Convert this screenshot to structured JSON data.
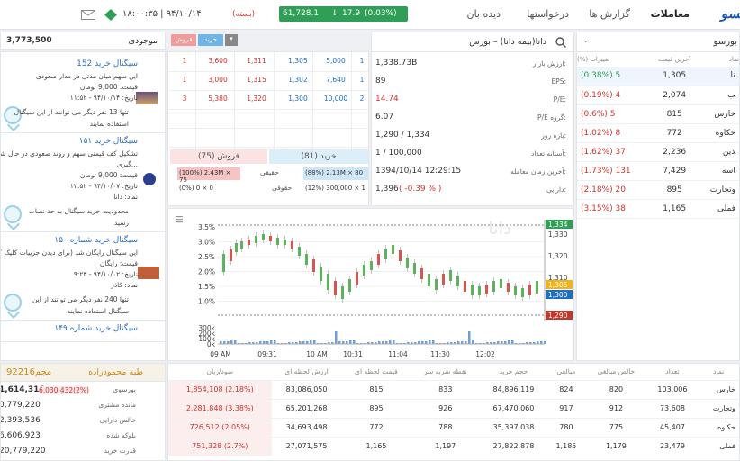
{
  "topbar": {
    "logo": "ﺴﻮ",
    "nav": [
      "معاملات",
      "گزارش ها",
      "درخواستها",
      "دیده بان"
    ],
    "index": {
      "value": "61,728.1",
      "change": "17.9",
      "percent": "(0.03%)"
    },
    "clock": "۱۸:۰۰:۳۵ | ۹۴/۱۰/۱۴",
    "clock_status": "(بسته)",
    "mail_icon": "mail-icon",
    "signal_icon": "signal-icon"
  },
  "watchlist": {
    "title": "بورسو",
    "headers": [
      "نماد",
      "آخرین قیمت",
      "تغییرات (%)"
    ],
    "rows": [
      {
        "symbol": "ﻨﺎ",
        "price": "1,305",
        "change": "(0.38%) 5",
        "dir": "green"
      },
      {
        "symbol": "ﺐ",
        "price": "2,074",
        "change": "(0.19%) 4",
        "dir": "red"
      },
      {
        "symbol": "خارس",
        "price": "815",
        "change": "(0.6%) 5",
        "dir": "red"
      },
      {
        "symbol": "حکاوه",
        "price": "772",
        "change": "(1.02%) 8",
        "dir": "red"
      },
      {
        "symbol": "ﺬﯾﻦ",
        "price": "2,236",
        "change": "(1.62%) 37",
        "dir": "red"
      },
      {
        "symbol": "ﺎﺳﻪ",
        "price": "7,429",
        "change": "(1.73%) 131",
        "dir": "red"
      },
      {
        "symbol": "وتجارت",
        "price": "895",
        "change": "(2.18%) 20",
        "dir": "red"
      },
      {
        "symbol": "فملی",
        "price": "1,165",
        "change": "(3.15%) 38",
        "dir": "red"
      }
    ]
  },
  "symbol_info": {
    "title": "دانا(بیمه دانا) – بورس",
    "fields": [
      {
        "label": "ارزش بازار:",
        "value": "1,338.73B",
        "color": "dark"
      },
      {
        "label": "EPS:",
        "value": "89",
        "color": "dark"
      },
      {
        "label": "P/E:",
        "value": "14.74",
        "color": "red"
      },
      {
        "label": "P/E گروه:",
        "value": "6.07",
        "color": "dark"
      },
      {
        "label": "بازه روز:",
        "value": "1,290 / 1,334",
        "color": "dark"
      },
      {
        "label": "آستانه تعداد:",
        "value": "1 / 100,000",
        "color": "dark"
      },
      {
        "label": "آخرین زمان معامله:",
        "value": "1394/10/14 12:29:15",
        "color": "dark"
      },
      {
        "label": "دارایی:",
        "value": "1,396",
        "extra": "( -0.39 % )",
        "color": "dark"
      }
    ]
  },
  "orderbook": {
    "rows": [
      {
        "c1": "1",
        "c2": "3,600",
        "c3": "1,311",
        "c4": "1,305",
        "c5": "5,000",
        "c6": "1"
      },
      {
        "c1": "1",
        "c2": "3,000",
        "c3": "1,315",
        "c4": "1,302",
        "c5": "7,640",
        "c6": "1"
      },
      {
        "c1": "3",
        "c2": "5,380",
        "c3": "1,320",
        "c4": "1,300",
        "c5": "10,000",
        "c6": "2"
      }
    ],
    "buy_title": "خرید (81)",
    "sell_title": "فروش (75)",
    "real": "حقیقی",
    "legal": "حقوقی",
    "buy_real": "(88%) 2.13M × 80",
    "buy_legal": "(12%) 300,000 × 1",
    "sell_real": "(100%) 2.43M × 75",
    "sell_legal": "(0%) 0 × 0"
  },
  "trade_panel": {
    "buy_btn": "خرید",
    "sell_btn": "فروش",
    "title": "موجودی",
    "balance": "3,773,500"
  },
  "signals": [
    {
      "title": "سیگنال خرید 152",
      "lines": [
        "این سهم میان مدتی در مدار صعودی",
        "قیمت: 9,000 تومان",
        "تاریخ: ۹۴/۱۰/۱۴ - ۱۱:۵۲"
      ],
      "note": [
        "تنها 13 نفر دیگر می توانند از این سیگنال",
        "استفاده نمایند"
      ]
    },
    {
      "title": "سیگنال خرید ۱۵۱",
      "lines": [
        "تشکیل کف قیمتی سهم و روند صعودی در حال شک",
        "گیری...",
        "قیمت: 9,000 تومان",
        "تاریخ: ۹۴/۱۰/۰۷ - ۱۲:۵۲",
        "نماد: دانا"
      ],
      "note": [
        "محدودیت خرید سیگنال به حد نصاب",
        "رسید"
      ]
    },
    {
      "title": "سیگنال خرید شماره ۱۵۰",
      "lines": [
        "این سیگنال رایگان شد (برای دیدن جزییات کلیک کنی",
        "قیمت: رایگان",
        "تاریخ: ۹۴/۱۰/۰۲ - ۹:۲۳",
        "نماد: کاذر"
      ],
      "note": [
        "تنها 240 نفر دیگر می توانند از این",
        "سیگنال استفاده نمایند"
      ]
    },
    {
      "title": "سیگنال خرید شماره ۱۴۹",
      "lines": [],
      "note": []
    }
  ],
  "portfolio": {
    "title": "طبه محمودزاده",
    "amount": "مجم92216",
    "rows": [
      {
        "label": "بورسوی",
        "value": "1,614,316",
        "extra": "6,030,432(2%)"
      },
      {
        "label": "مانده مشتری",
        "value": "0,779,220",
        "extra": ""
      },
      {
        "label": "خالص دارایی",
        "value": "2,393,536",
        "extra": ""
      },
      {
        "label": "بلوکه شده",
        "value": "6,606,923",
        "extra": ""
      },
      {
        "label": "قدرت خرید",
        "value": "20,779,220",
        "extra": ""
      }
    ]
  },
  "bottom_table": {
    "headers": [
      "نماد",
      "تعداد",
      "خالص مبالغی",
      "مبالغی",
      "حجم خرید",
      "نقطه سربه سر",
      "قیمت لحظه ای",
      "ارزش لحظه ای",
      "سود/زیان"
    ],
    "rows": [
      {
        "sym": "خارس",
        "count": "103,006",
        "net": "820",
        "amt": "824",
        "vol": "84,896,119",
        "be": "833",
        "price": "815",
        "val": "83,086,050",
        "pl": "1,854,108 (2.18%)"
      },
      {
        "sym": "وتجارت",
        "count": "73,608",
        "net": "912",
        "amt": "917",
        "vol": "67,470,060",
        "be": "926",
        "price": "895",
        "val": "65,201,268",
        "pl": "2,281,848 (3.38%)"
      },
      {
        "sym": "حکاوه",
        "count": "45,407",
        "net": "775",
        "amt": "780",
        "vol": "35,397,038",
        "be": "788",
        "price": "772",
        "val": "34,693,498",
        "pl": "726,512 (2.05%)"
      },
      {
        "sym": "فملی",
        "count": "23,479",
        "net": "1,179",
        "amt": "1,185",
        "vol": "27,822,878",
        "be": "1,197",
        "price": "1,165",
        "val": "27,071,575",
        "pl": "751,328 (2.7%)"
      }
    ]
  },
  "chart": {
    "watermark": "دانا",
    "pct_ticks": [
      "3.5%",
      "3.0%",
      "2.5%",
      "2.0%",
      "1.5%",
      "1.0%"
    ],
    "price_ticks": [
      "1,330",
      "1,320",
      "1,310"
    ],
    "price_markers": [
      {
        "v": "1,334",
        "c": "#2f9e57"
      },
      {
        "v": "1,305",
        "c": "#f2b21b"
      },
      {
        "v": "1,300",
        "c": "#1f6fc0"
      },
      {
        "v": "1,290",
        "c": "#c0392b"
      }
    ],
    "vol_ticks": [
      "300k",
      "200k",
      "100k",
      "0k"
    ],
    "x_ticks": [
      "09 AM",
      "09:31",
      "10 AM",
      "10:31",
      "11:04",
      "11:30",
      "12:02"
    ],
    "menu_icon": "menu-icon"
  }
}
